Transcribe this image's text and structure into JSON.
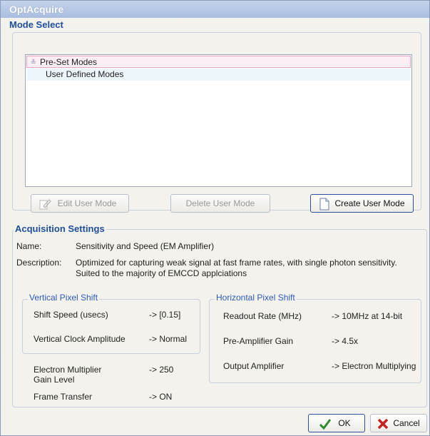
{
  "window": {
    "title": "OptAcquire"
  },
  "mode_select": {
    "header": "Mode Select",
    "items": [
      {
        "label": "Pre-Set Modes",
        "expander": "≚"
      },
      {
        "label": "User Defined Modes"
      }
    ],
    "buttons": {
      "edit": "Edit User Mode",
      "delete": "Delete User Mode",
      "create": "Create User Mode"
    }
  },
  "acquisition": {
    "header": "Acquisition Settings",
    "name_label": "Name:",
    "name_value": "Sensitivity and Speed (EM Amplifier)",
    "description_label": "Description:",
    "description_line1": "Optimized for capturing weak signal at fast frame rates, with single photon sensitivity.",
    "description_line2": "Suited to the majority of EMCCD applciations",
    "vertical": {
      "header": "Vertical Pixel Shift",
      "shift_speed_label": "Shift Speed (usecs)",
      "shift_speed_value": "-> [0.15]",
      "clock_amp_label": "Vertical Clock Amplitude",
      "clock_amp_value": "-> Normal"
    },
    "horizontal": {
      "header": "Horizontal Pixel Shift",
      "readout_label": "Readout Rate (MHz)",
      "readout_value": "-> 10MHz at 14-bit",
      "preamp_label": "Pre-Amplifier Gain",
      "preamp_value": "-> 4.5x",
      "output_label": "Output Amplifier",
      "output_value": "-> Electron Multiplying"
    },
    "em_gain_label_line1": "Electron Multiplier",
    "em_gain_label_line2": "Gain Level",
    "em_gain_value": "-> 250",
    "frame_transfer_label": "Frame Transfer",
    "frame_transfer_value": "-> ON"
  },
  "footer": {
    "ok": "OK",
    "cancel": "Cancel"
  },
  "colors": {
    "accent": "#1e4f9c",
    "ok_check": "#2e8b2e",
    "cancel_x": "#c62020"
  }
}
